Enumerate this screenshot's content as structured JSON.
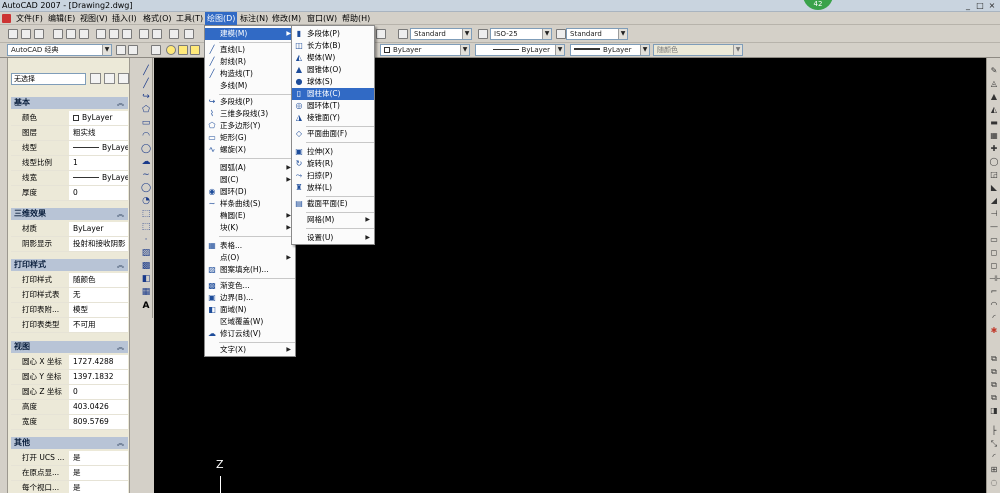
{
  "window": {
    "title": "AutoCAD 2007 - [Drawing2.dwg]",
    "badge": "42",
    "controls": [
      "_",
      "□",
      "×"
    ]
  },
  "menubar": {
    "items": [
      {
        "label": "文件(F)"
      },
      {
        "label": "编辑(E)"
      },
      {
        "label": "视图(V)"
      },
      {
        "label": "插入(I)"
      },
      {
        "label": "格式(O)"
      },
      {
        "label": "工具(T)"
      },
      {
        "label": "绘图(D)"
      },
      {
        "label": "标注(N)"
      },
      {
        "label": "修改(M)"
      },
      {
        "label": "窗口(W)"
      },
      {
        "label": "帮助(H)"
      }
    ],
    "active_index": 6
  },
  "toolbar": {
    "text_style": "Standard",
    "dim_style": "ISO-25",
    "table_style": "Standard",
    "workspace": "AutoCAD 经典",
    "layer_color": "ByLayer",
    "linetype": "ByLayer",
    "lineweight": "ByLayer",
    "plot_style": "随颜色"
  },
  "palette": {
    "selection": "无选择",
    "sections": {
      "basic": {
        "title": "基本",
        "rows": [
          {
            "key": "颜色",
            "value": "ByLayer"
          },
          {
            "key": "图层",
            "value": "粗实线"
          },
          {
            "key": "线型",
            "value": "ByLayer"
          },
          {
            "key": "线型比例",
            "value": "1"
          },
          {
            "key": "线宽",
            "value": "ByLayer"
          },
          {
            "key": "厚度",
            "value": "0"
          }
        ]
      },
      "threed": {
        "title": "三维效果",
        "rows": [
          {
            "key": "材质",
            "value": "ByLayer"
          },
          {
            "key": "阴影显示",
            "value": "投射和接收阴影"
          }
        ]
      },
      "print": {
        "title": "打印样式",
        "rows": [
          {
            "key": "打印样式",
            "value": "随颜色"
          },
          {
            "key": "打印样式表",
            "value": "无"
          },
          {
            "key": "打印表附...",
            "value": "模型"
          },
          {
            "key": "打印表类型",
            "value": "不可用"
          }
        ]
      },
      "view": {
        "title": "视图",
        "rows": [
          {
            "key": "圆心 X 坐标",
            "value": "1727.4288"
          },
          {
            "key": "圆心 Y 坐标",
            "value": "1397.1832"
          },
          {
            "key": "圆心 Z 坐标",
            "value": "0"
          },
          {
            "key": "高度",
            "value": "403.0426"
          },
          {
            "key": "宽度",
            "value": "809.5769"
          }
        ]
      },
      "misc": {
        "title": "其他",
        "rows": [
          {
            "key": "打开 UCS ...",
            "value": "是"
          },
          {
            "key": "在原点显...",
            "value": "是"
          },
          {
            "key": "每个视口...",
            "value": "是"
          }
        ]
      }
    }
  },
  "draw_menu": {
    "items": [
      {
        "label": "建模(M)",
        "icon": "",
        "sub": true
      },
      {
        "label": "直线(L)",
        "icon": "╱"
      },
      {
        "label": "射线(R)",
        "icon": "╱"
      },
      {
        "label": "构造线(T)",
        "icon": "╱"
      },
      {
        "label": "多线(M)",
        "icon": ""
      },
      {
        "label": "多段线(P)",
        "icon": "↪"
      },
      {
        "label": "三维多段线(3)",
        "icon": "⌇"
      },
      {
        "label": "正多边形(Y)",
        "icon": "⬠"
      },
      {
        "label": "矩形(G)",
        "icon": "▭"
      },
      {
        "label": "螺旋(X)",
        "icon": "∿"
      },
      {
        "label": "圆弧(A)",
        "icon": "",
        "sub": true
      },
      {
        "label": "圆(C)",
        "icon": "",
        "sub": true
      },
      {
        "label": "圆环(D)",
        "icon": "◉"
      },
      {
        "label": "样条曲线(S)",
        "icon": "∼"
      },
      {
        "label": "椭圆(E)",
        "icon": "",
        "sub": true
      },
      {
        "label": "块(K)",
        "icon": "",
        "sub": true
      },
      {
        "label": "表格...",
        "icon": "▦"
      },
      {
        "label": "点(O)",
        "icon": "",
        "sub": true
      },
      {
        "label": "图案填充(H)...",
        "icon": "▨"
      },
      {
        "label": "渐变色...",
        "icon": "▩"
      },
      {
        "label": "边界(B)...",
        "icon": "▣"
      },
      {
        "label": "面域(N)",
        "icon": "◧"
      },
      {
        "label": "区域覆盖(W)",
        "icon": ""
      },
      {
        "label": "修订云线(V)",
        "icon": "☁"
      },
      {
        "label": "文字(X)",
        "icon": "",
        "sub": true
      }
    ]
  },
  "modeling_menu": {
    "items": [
      {
        "label": "多段体(P)",
        "icon": "▮"
      },
      {
        "label": "长方体(B)",
        "icon": "◫"
      },
      {
        "label": "楔体(W)",
        "icon": "◭"
      },
      {
        "label": "圆锥体(O)",
        "icon": "▲"
      },
      {
        "label": "球体(S)",
        "icon": "●"
      },
      {
        "label": "圆柱体(C)",
        "icon": "▯"
      },
      {
        "label": "圆环体(T)",
        "icon": "◎"
      },
      {
        "label": "棱锥面(Y)",
        "icon": "◮"
      },
      {
        "label": "平面曲面(F)",
        "icon": "◇"
      },
      {
        "label": "拉伸(X)",
        "icon": "▣"
      },
      {
        "label": "旋转(R)",
        "icon": "↻"
      },
      {
        "label": "扫掠(P)",
        "icon": "⤳"
      },
      {
        "label": "放样(L)",
        "icon": "♜"
      },
      {
        "label": "截面平面(E)",
        "icon": "▤"
      },
      {
        "label": "网格(M)",
        "icon": "",
        "sub": true
      },
      {
        "label": "设置(U)",
        "icon": "",
        "sub": true
      }
    ],
    "highlighted_index": 5
  },
  "canvas": {
    "ucs_label": "Z"
  },
  "draw_toolbar_icons": [
    "╱",
    "╱",
    "↪",
    "⬠",
    "▭",
    "◠",
    "◯",
    "☁",
    "∼",
    "◯",
    "◔",
    "⬚",
    "⬚",
    "·",
    "▨",
    "▩",
    "◧",
    "▦",
    "A"
  ],
  "right_toolbar_icons": [
    "✎",
    "◬",
    "▲",
    "◭",
    "▬",
    "▦",
    "✚",
    "◯",
    "◲",
    "◣",
    "◢",
    "⊣",
    "—",
    "▭",
    "◻",
    "◻",
    "⊣⊢",
    "⌐",
    "◠",
    "◜",
    "✱",
    "",
    "⧉",
    "⧉",
    "⧉",
    "⧉",
    "◨",
    "",
    "├",
    "⤡",
    "◜",
    "⊞",
    "◌",
    "◌",
    "⊘",
    "⊙",
    "∠"
  ]
}
